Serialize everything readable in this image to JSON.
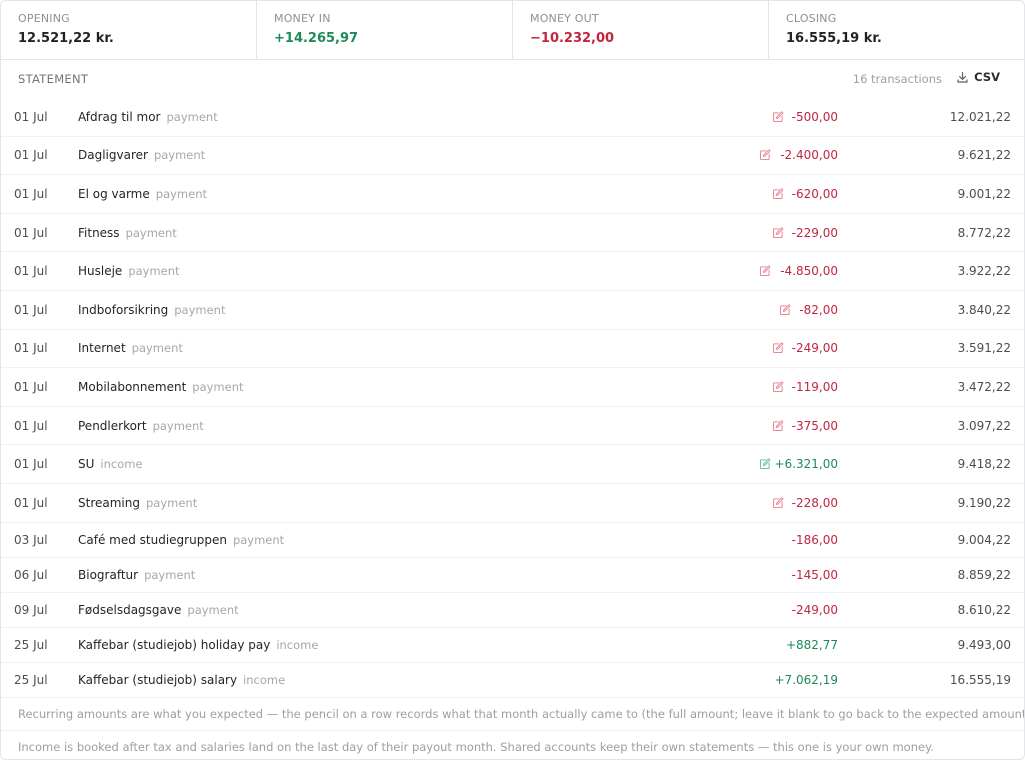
{
  "summary": {
    "opening": {
      "label": "OPENING",
      "value": "12.521,22 kr."
    },
    "money_in": {
      "label": "MONEY IN",
      "value": "+14.265,97"
    },
    "money_out": {
      "label": "MONEY OUT",
      "value": "−10.232,00"
    },
    "closing": {
      "label": "CLOSING",
      "value": "16.555,19 kr."
    }
  },
  "statement": {
    "title": "STATEMENT",
    "count": "16 transactions",
    "csv_label": "CSV",
    "rows": [
      {
        "date": "01 Jul",
        "desc": "Afdrag til mor",
        "kind": "payment",
        "amount": "-500,00",
        "balance": "12.021,22",
        "sign": "neg",
        "editable": true
      },
      {
        "date": "01 Jul",
        "desc": "Dagligvarer",
        "kind": "payment",
        "amount": "-2.400,00",
        "balance": "9.621,22",
        "sign": "neg",
        "editable": true
      },
      {
        "date": "01 Jul",
        "desc": "El og varme",
        "kind": "payment",
        "amount": "-620,00",
        "balance": "9.001,22",
        "sign": "neg",
        "editable": true
      },
      {
        "date": "01 Jul",
        "desc": "Fitness",
        "kind": "payment",
        "amount": "-229,00",
        "balance": "8.772,22",
        "sign": "neg",
        "editable": true
      },
      {
        "date": "01 Jul",
        "desc": "Husleje",
        "kind": "payment",
        "amount": "-4.850,00",
        "balance": "3.922,22",
        "sign": "neg",
        "editable": true
      },
      {
        "date": "01 Jul",
        "desc": "Indboforsikring",
        "kind": "payment",
        "amount": "-82,00",
        "balance": "3.840,22",
        "sign": "neg",
        "editable": true
      },
      {
        "date": "01 Jul",
        "desc": "Internet",
        "kind": "payment",
        "amount": "-249,00",
        "balance": "3.591,22",
        "sign": "neg",
        "editable": true
      },
      {
        "date": "01 Jul",
        "desc": "Mobilabonnement",
        "kind": "payment",
        "amount": "-119,00",
        "balance": "3.472,22",
        "sign": "neg",
        "editable": true
      },
      {
        "date": "01 Jul",
        "desc": "Pendlerkort",
        "kind": "payment",
        "amount": "-375,00",
        "balance": "3.097,22",
        "sign": "neg",
        "editable": true
      },
      {
        "date": "01 Jul",
        "desc": "SU",
        "kind": "income",
        "amount": "+6.321,00",
        "balance": "9.418,22",
        "sign": "pos",
        "editable": true
      },
      {
        "date": "01 Jul",
        "desc": "Streaming",
        "kind": "payment",
        "amount": "-228,00",
        "balance": "9.190,22",
        "sign": "neg",
        "editable": true
      },
      {
        "date": "03 Jul",
        "desc": "Café med studiegruppen",
        "kind": "payment",
        "amount": "-186,00",
        "balance": "9.004,22",
        "sign": "neg",
        "editable": false
      },
      {
        "date": "06 Jul",
        "desc": "Biograftur",
        "kind": "payment",
        "amount": "-145,00",
        "balance": "8.859,22",
        "sign": "neg",
        "editable": false
      },
      {
        "date": "09 Jul",
        "desc": "Fødselsdagsgave",
        "kind": "payment",
        "amount": "-249,00",
        "balance": "8.610,22",
        "sign": "neg",
        "editable": false
      },
      {
        "date": "25 Jul",
        "desc": "Kaffebar (studiejob) holiday pay",
        "kind": "income",
        "amount": "+882,77",
        "balance": "9.493,00",
        "sign": "pos",
        "editable": false
      },
      {
        "date": "25 Jul",
        "desc": "Kaffebar (studiejob) salary",
        "kind": "income",
        "amount": "+7.062,19",
        "balance": "16.555,19",
        "sign": "pos",
        "editable": false
      }
    ]
  },
  "notes": [
    "Recurring amounts are what you expected — the pencil on a row records what that month actually came to (the full amount; leave it blank to go back to the expected amount).",
    "Income is booked after tax and salaries land on the last day of their payout month. Shared accounts keep their own statements — this one is your own money."
  ],
  "colors": {
    "negative": "#c2263f",
    "positive": "#1e8a5a",
    "edit_negative": "#e88a9a",
    "edit_positive": "#6cc49a"
  },
  "icons": {
    "edit": "pencil-icon",
    "download": "download-icon"
  }
}
